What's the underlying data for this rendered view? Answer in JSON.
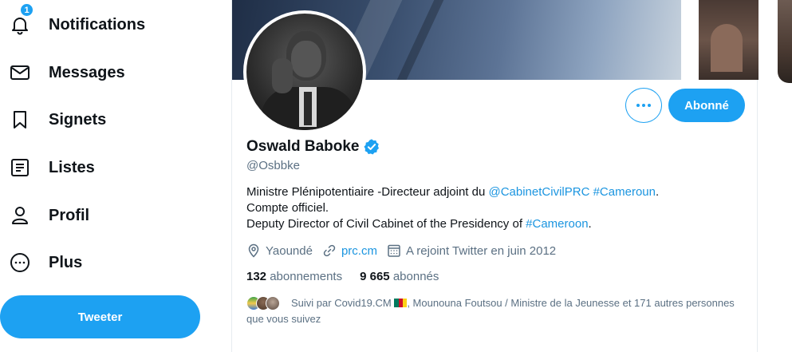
{
  "nav": {
    "items": [
      {
        "key": "notifications",
        "label": "Notifications",
        "icon": "bell-icon",
        "badge": "1"
      },
      {
        "key": "messages",
        "label": "Messages",
        "icon": "envelope-icon"
      },
      {
        "key": "bookmarks",
        "label": "Signets",
        "icon": "bookmark-icon"
      },
      {
        "key": "lists",
        "label": "Listes",
        "icon": "list-icon"
      },
      {
        "key": "profile",
        "label": "Profil",
        "icon": "person-icon"
      },
      {
        "key": "more",
        "label": "Plus",
        "icon": "more-circle-icon"
      }
    ],
    "tweet_button": "Tweeter"
  },
  "profile": {
    "name": "Oswald Baboke",
    "handle": "@Osbbke",
    "verified": true,
    "follow_button": "Abonné",
    "bio": {
      "line1_text": "Ministre Plénipotentiaire -Directeur adjoint du ",
      "line1_mention": "@CabinetCivilPRC",
      "line1_hashtag": "#Cameroun",
      "line1_end": ".",
      "line2": "Compte officiel.",
      "line3_text": "Deputy Director of Civil Cabinet of the Presidency of ",
      "line3_hashtag": "#Cameroon",
      "line3_end": "."
    },
    "location": "Yaoundé",
    "website": "prc.cm",
    "joined": "A rejoint Twitter en juin 2012",
    "following_count": "132",
    "following_label": "abonnements",
    "followers_count": "9 665",
    "followers_label": "abonnés",
    "followed_by": {
      "prefix": "Suivi par Covid19.CM ",
      "rest": ", Mounouna Foutsou / Ministre de la Jeunesse et 171 autres personnes que vous suivez"
    }
  },
  "colors": {
    "accent": "#1da1f2",
    "link": "#1b95e0",
    "secondary_text": "#5b7083",
    "cameroon_flag": [
      "#007a5e",
      "#ce1126",
      "#fcd116"
    ]
  }
}
